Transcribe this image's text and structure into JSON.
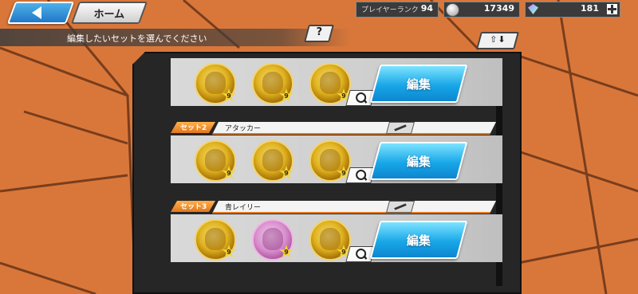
{
  "top_bar": {
    "home_label": "ホーム",
    "player_rank_label": "プレイヤーランク",
    "player_rank_value": "94",
    "coin_value": "17349",
    "gem_value": "181"
  },
  "instruction": {
    "text": "編集したいセットを選んでください",
    "help_label": "?",
    "sort_label": "⇧⬇"
  },
  "sets": [
    {
      "tag": "",
      "name": "",
      "edit_label": "編集",
      "slots": [
        {
          "type": "gold",
          "level": "9"
        },
        {
          "type": "gold",
          "level": "9"
        },
        {
          "type": "gold",
          "level": "9"
        }
      ]
    },
    {
      "tag": "セット2",
      "name": "アタッカー",
      "edit_label": "編集",
      "slots": [
        {
          "type": "gold",
          "level": "9"
        },
        {
          "type": "gold",
          "level": "9"
        },
        {
          "type": "gold",
          "level": "9"
        }
      ]
    },
    {
      "tag": "セット3",
      "name": "青レイリー",
      "edit_label": "編集",
      "slots": [
        {
          "type": "gold",
          "level": "9"
        },
        {
          "type": "pink",
          "level": "9"
        },
        {
          "type": "gold",
          "level": "9"
        }
      ]
    }
  ],
  "colors": {
    "background": "#d9773a",
    "accent_orange": "#e2761c",
    "edit_button_blue": "#18a7e8"
  }
}
